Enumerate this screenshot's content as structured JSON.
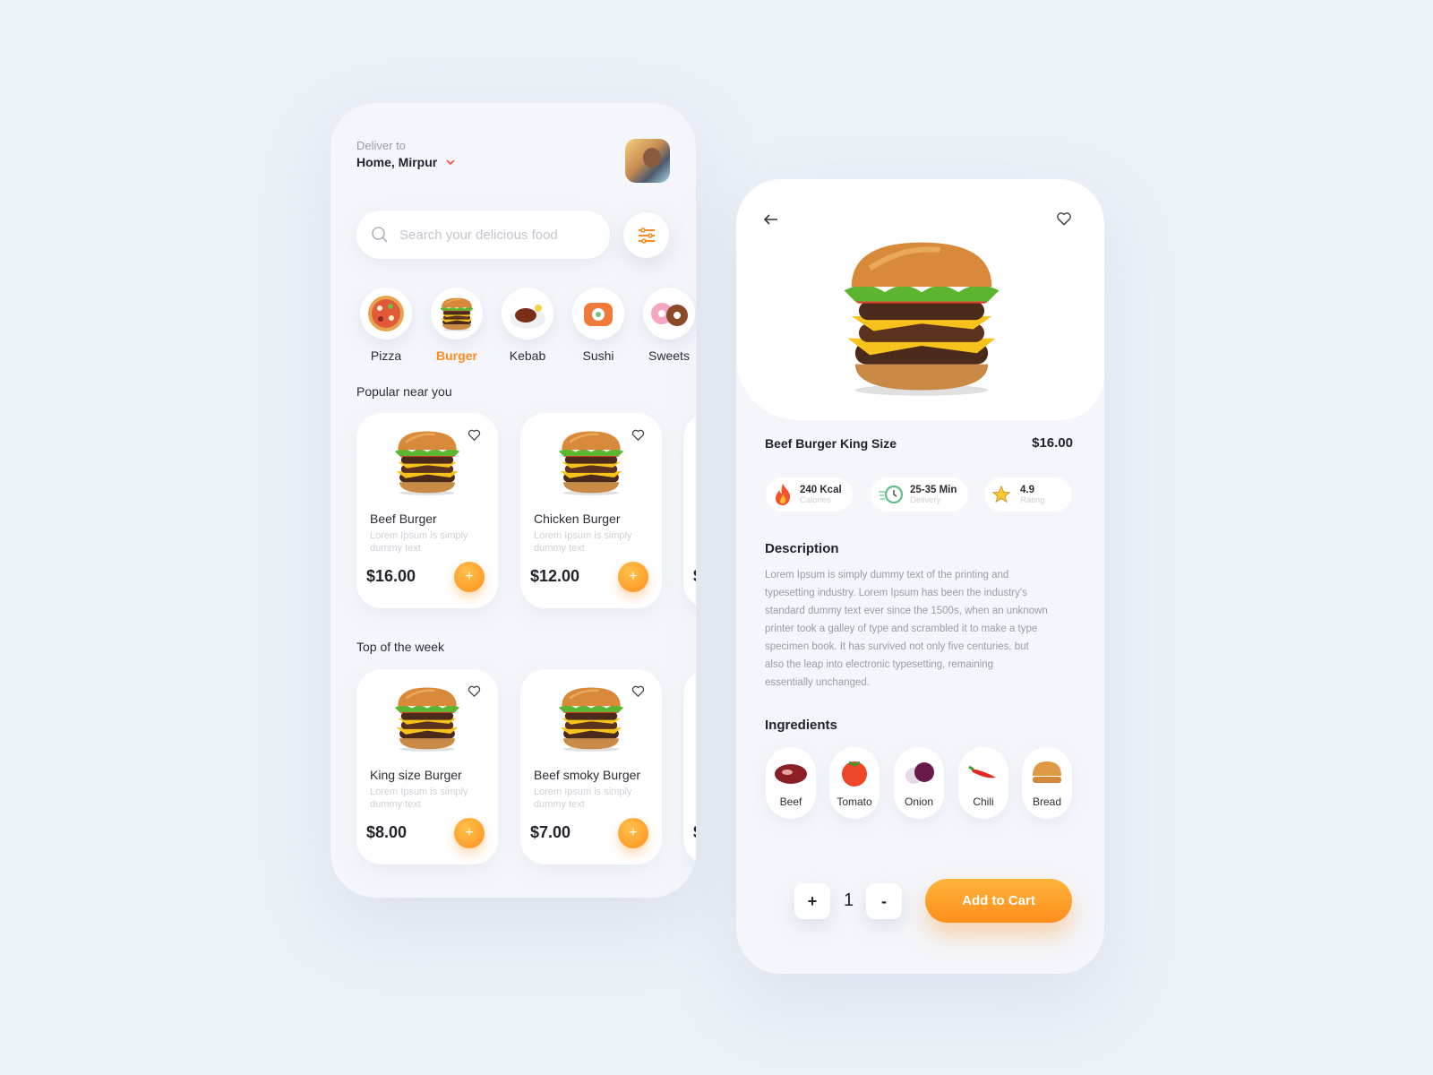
{
  "home": {
    "deliver_label": "Deliver to",
    "location": "Home, Mirpur",
    "search_placeholder": "Search your delicious food",
    "categories": [
      {
        "label": "Pizza",
        "icon": "pizza-icon"
      },
      {
        "label": "Burger",
        "icon": "burger-icon",
        "active": true
      },
      {
        "label": "Kebab",
        "icon": "kebab-icon"
      },
      {
        "label": "Sushi",
        "icon": "sushi-icon"
      },
      {
        "label": "Sweets",
        "icon": "donut-icon"
      }
    ],
    "popular_title": "Popular near you",
    "popular": [
      {
        "name": "Beef Burger",
        "desc": "Lorem Ipsum is simply dummy text",
        "price": "$16.00"
      },
      {
        "name": "Chicken Burger",
        "desc": "Lorem Ipsum is simply dummy text",
        "price": "$12.00"
      },
      {
        "price": "$"
      }
    ],
    "week_title": "Top of the week",
    "week": [
      {
        "name": "King size Burger",
        "desc": "Lorem Ipsum is simply dummy text",
        "price": "$8.00"
      },
      {
        "name": "Beef smoky Burger",
        "desc": "Lorem Ipsum is simply dummy text",
        "price": "$7.00"
      },
      {
        "price": "$"
      }
    ],
    "plus_label": "+"
  },
  "detail": {
    "title": "Beef Burger King Size",
    "price": "$16.00",
    "stats": [
      {
        "value": "240 Kcal",
        "label": "Calories",
        "icon": "fire-icon"
      },
      {
        "value": "25-35 Min",
        "label": "Delivery",
        "icon": "clock-icon"
      },
      {
        "value": "4.9",
        "label": "Rating",
        "icon": "star-icon"
      }
    ],
    "description_title": "Description",
    "description_lines": [
      "Lorem Ipsum is simply dummy text of the printing and",
      "typesetting industry. Lorem Ipsum has been the industry's",
      "standard dummy text ever since the 1500s, when an unknown",
      "printer took a galley of type and scrambled it to make a type",
      "specimen book. It has survived not only five centuries, but",
      "also the leap into electronic typesetting, remaining",
      "essentially unchanged."
    ],
    "ingredients_title": "Ingredients",
    "ingredients": [
      "Beef",
      "Tomato",
      "Onion",
      "Chili",
      "Bread"
    ],
    "quantity": "1",
    "plus": "+",
    "minus": "-",
    "add_to_cart": "Add to Cart"
  },
  "colors": {
    "accent": "#ff8a1e",
    "background": "#edf1f8",
    "card": "#f4f6fb"
  }
}
